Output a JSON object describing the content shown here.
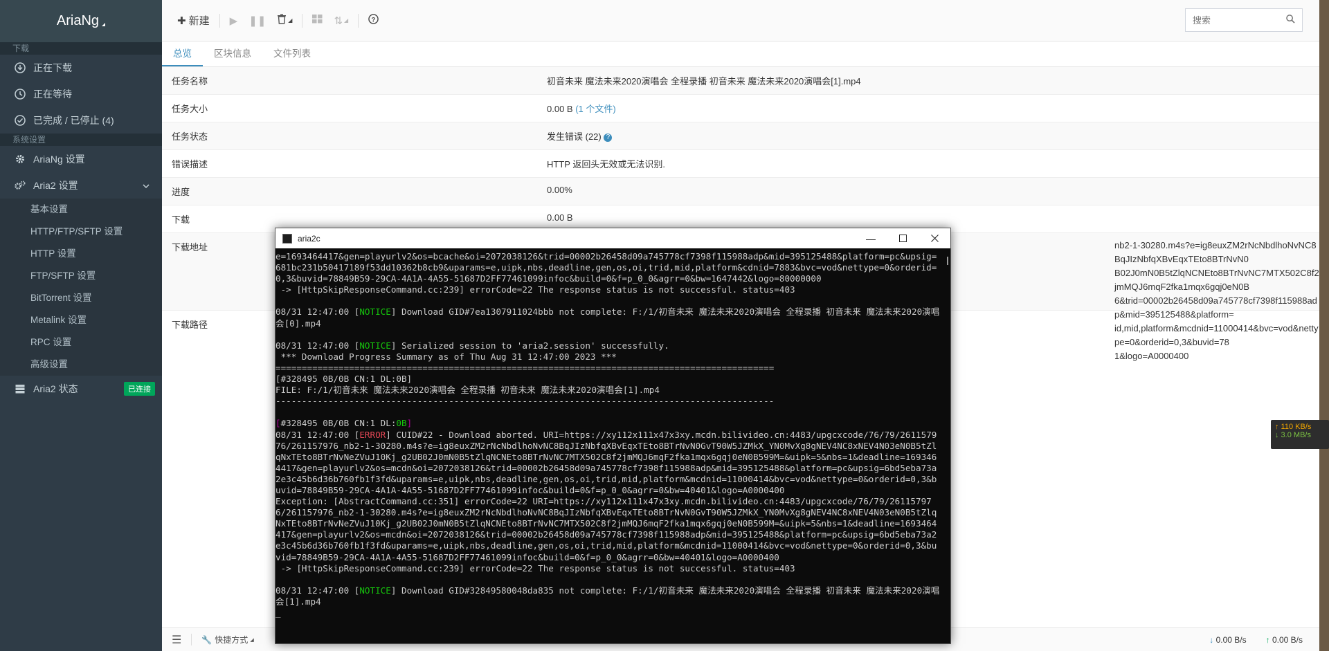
{
  "sidebar": {
    "brand": "AriaNg",
    "section_download": "下载",
    "downloading": "正在下载",
    "waiting": "正在等待",
    "stopped": "已完成 / 已停止 (4)",
    "section_settings": "系统设置",
    "ariang_settings": "AriaNg 设置",
    "aria2_settings": "Aria2 设置",
    "sub_items": [
      "基本设置",
      "HTTP/FTP/SFTP 设置",
      "HTTP 设置",
      "FTP/SFTP 设置",
      "BitTorrent 设置",
      "Metalink 设置",
      "RPC 设置",
      "高级设置"
    ],
    "aria2_status": "Aria2 状态",
    "connected_badge": "已连接"
  },
  "toolbar": {
    "new_label": "新建",
    "search_placeholder": "搜索"
  },
  "tabs": [
    "总览",
    "区块信息",
    "文件列表"
  ],
  "task": {
    "name_label": "任务名称",
    "name_value": "初音未来 魔法未来2020演唱会 全程录播 初音未来 魔法未来2020演唱会[1].mp4",
    "size_label": "任务大小",
    "size_value": "0.00 B",
    "size_files": "(1 个文件)",
    "status_label": "任务状态",
    "status_value": "发生错误 (22)",
    "error_label": "错误描述",
    "error_value": "HTTP 返回头无效或无法识别.",
    "progress_label": "进度",
    "progress_value": "0.00%",
    "download_label": "下载",
    "download_value": "0.00 B",
    "url_label": "下载地址",
    "url_value_1": "nb2-1-30280.m4s?e=ig8euxZM2rNcNbdlhoNvNC8BqJIzNbfqXBvEqxTEto8BTrNvN0",
    "url_value_2": "B02J0mN0B5tZlqNCNEto8BTrNvNC7MTX502C8f2jmMQJ6mqF2fka1mqx6gqj0eN0B",
    "url_value_3": "6&trid=00002b26458d09a745778cf7398f115988adp&mid=395125488&platform=",
    "url_value_4": "id,mid,platform&mcdnid=11000414&bvc=vod&nettype=0&orderid=0,3&buvid=78",
    "url_value_5": "1&logo=A0000400",
    "path_label": "下载路径"
  },
  "footer": {
    "shortcut": "快捷方式",
    "down_speed": "0.00 B/s",
    "up_speed": "0.00 B/s"
  },
  "speed_widget": {
    "up": "↑ 110 KB/s",
    "down": "↓ 3.0 MB/s"
  },
  "console": {
    "title": "aria2c",
    "l01": "e=1693464417&gen=playurlv2&os=bcache&oi=2072038126&trid=00002b26458d09a745778cf7398f115988adp&mid=395125488&platform=pc&upsig=681bc231b50417189f53dd10362b8cb9&uparams=e,uipk,nbs,deadline,gen,os,oi,trid,mid,platform&cdnid=7883&bvc=vod&nettype=0&orderid=0,3&buvid=78849B59-29CA-4A1A-4A55-51687D2FF77461099infoc&build=0&f=p_0_0&agrr=0&bw=1647442&logo=80000000",
    "l02": " -> [HttpSkipResponseCommand.cc:239] errorCode=22 The response status is not successful. status=403",
    "l03_pre": "08/31 12:47:00 [",
    "notice": "NOTICE",
    "error": "ERROR",
    "l03_post": "] Download GID#7ea1307911024bbb not complete: F:/1/初音未来 魔法未来2020演唱会 全程录播 初音未来 魔法未来2020演唱会[0].mp4",
    "l04_post": "] Serialized session to 'aria2.session' successfully.",
    "l05": " *** Download Progress Summary as of Thu Aug 31 12:47:00 2023 ***",
    "l06": "===============================================================================================",
    "l07": "[#328495 0B/0B CN:1 DL:0B]",
    "l08": "FILE: F:/1/初音未来 魔法未来2020演唱会 全程录播 初音未来 魔法未来2020演唱会[1].mp4",
    "l09": "-----------------------------------------------------------------------------------------------",
    "l10_a": "[",
    "l10_b": "#328495 0B/0B CN:1 DL:",
    "l10_c": "0B",
    "l10_d": "]",
    "l11_post": "] CUID#22 - Download aborted. URI=https://xy112x111x47x3xy.mcdn.bilivideo.cn:4483/upgcxcode/76/79/261157976/261157976_nb2-1-30280.m4s?e=ig8euxZM2rNcNbdlhoNvNC8BqJIzNbfqXBvEqxTEto8BTrNvN0GvT90W5JZMkX_YN0MvXg8gNEV4NC8xNEV4N03eN0B5tZlqNxTEto8BTrNvNeZVuJ10Kj_g2UB02J0mN0B5tZlqNCNEto8BTrNvNC7MTX502C8f2jmMQJ6mqF2fka1mqx6gqj0eN0B599M=&uipk=5&nbs=1&deadline=1693464417&gen=playurlv2&os=mcdn&oi=2072038126&trid=00002b26458d09a745778cf7398f115988adp&mid=395125488&platform=pc&upsig=6bd5eba73a2e3c45b6d36b760fb1f3fd&uparams=e,uipk,nbs,deadline,gen,os,oi,trid,mid,platform&mcdnid=11000414&bvc=vod&nettype=0&orderid=0,3&buvid=78849B59-29CA-4A1A-4A55-51687D2FF77461099infoc&build=0&f=p_0_0&agrr=0&bw=40401&logo=A0000400",
    "l12": "Exception: [AbstractCommand.cc:351] errorCode=22 URI=https://xy112x111x47x3xy.mcdn.bilivideo.cn:4483/upgcxcode/76/79/261157976/261157976_nb2-1-30280.m4s?e=ig8euxZM2rNcNbdlhoNvNC8BqJIzNbfqXBvEqxTEto8BTrNvN0GvT90W5JZMkX_YN0MvXg8gNEV4NC8xNEV4N03eN0B5tZlqNxTEto8BTrNvNeZVuJ10Kj_g2UB02J0mN0B5tZlqNCNEto8BTrNvNC7MTX502C8f2jmMQJ6mqF2fka1mqx6gqj0eN0B599M=&uipk=5&nbs=1&deadline=1693464417&gen=playurlv2&os=mcdn&oi=2072038126&trid=00002b26458d09a745778cf7398f115988adp&mid=395125488&platform=pc&upsig=6bd5eba73a2e3c45b6d36b760fb1f3fd&uparams=e,uipk,nbs,deadline,gen,os,oi,trid,mid,platform&mcdnid=11000414&bvc=vod&nettype=0&orderid=0,3&buvid=78849B59-29CA-4A1A-4A55-51687D2FF77461099infoc&build=0&f=p_0_0&agrr=0&bw=40401&logo=A0000400",
    "l13": " -> [HttpSkipResponseCommand.cc:239] errorCode=22 The response status is not successful. status=403",
    "l14_post": "] Download GID#32849580048da835 not complete: F:/1/初音未来 魔法未来2020演唱会 全程录播 初音未来 魔法未来2020演唱会[1].mp4",
    "cursor": "_"
  },
  "colors": {
    "sidebar_bg": "#2f3c47",
    "accent": "#3c8dbc",
    "success": "#00a65a",
    "console_bg": "#0c0c0c",
    "notice_green": "#16c60c",
    "error_red": "#e74856"
  }
}
